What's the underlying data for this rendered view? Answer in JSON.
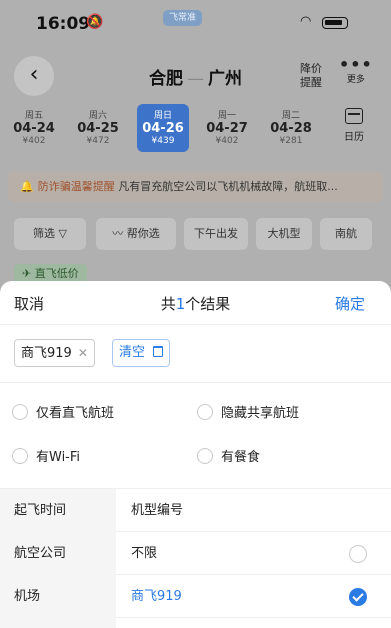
{
  "status_bar": {
    "time": "16:09",
    "app_badge": "飞常准"
  },
  "header": {
    "route_from": "合肥",
    "route_sep": "—",
    "route_to": "广州",
    "lowprice_line1": "降价",
    "lowprice_line2": "提醒",
    "more_label": "更多"
  },
  "dates": [
    {
      "weekday": "周五",
      "date": "04-24",
      "price": "¥402",
      "selected": false
    },
    {
      "weekday": "周六",
      "date": "04-25",
      "price": "¥472",
      "selected": false
    },
    {
      "weekday": "周日",
      "date": "04-26",
      "price": "¥439",
      "selected": true
    },
    {
      "weekday": "周一",
      "date": "04-27",
      "price": "¥402",
      "selected": false
    },
    {
      "weekday": "周二",
      "date": "04-28",
      "price": "¥281",
      "selected": false
    }
  ],
  "calendar_label": "日历",
  "notice": {
    "highlight": "防诈骗温馨提醒",
    "text": "凡有冒充航空公司以飞机机械故障，航班取..."
  },
  "filters": [
    "筛选",
    "帮你选",
    "下午出发",
    "大机型",
    "南航"
  ],
  "direct_tag": "✈ 直飞低价",
  "sheet": {
    "cancel": "取消",
    "result_prefix": "共",
    "result_count": "1",
    "result_suffix": "个结果",
    "confirm": "确定",
    "selected_tag": "商飞919",
    "clear_label": "清空",
    "options": [
      "仅看直飞航班",
      "隐藏共享航班",
      "有Wi-Fi",
      "有餐食"
    ],
    "categories": [
      "起飞时间",
      "航空公司",
      "机场"
    ],
    "right_header": "机型编号",
    "right_items": [
      {
        "label": "不限",
        "checked": false
      },
      {
        "label": "商飞919",
        "checked": true
      }
    ]
  }
}
